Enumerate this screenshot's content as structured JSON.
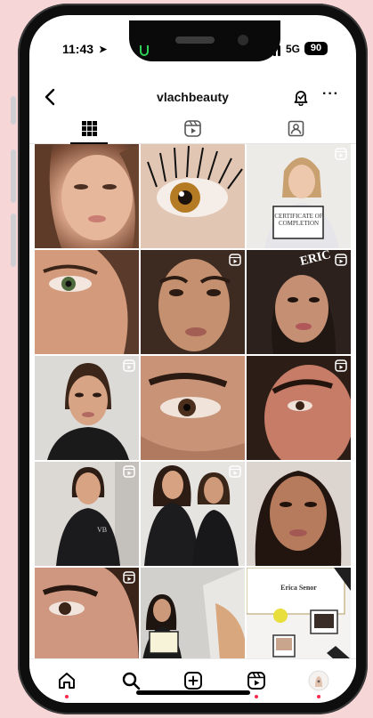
{
  "status_bar": {
    "time": "11:43",
    "network": "5G",
    "battery": "90"
  },
  "profile": {
    "username": "vlachbeauty"
  },
  "grid_posts": [
    {
      "caption": ""
    },
    {
      "caption": ""
    },
    {
      "caption": "CERTIFICATE OF COMPLETION"
    },
    {
      "caption": ""
    },
    {
      "caption": ""
    },
    {
      "caption": "ERIC"
    },
    {
      "caption": ""
    },
    {
      "caption": ""
    },
    {
      "caption": ""
    },
    {
      "caption": "VB"
    },
    {
      "caption": ""
    },
    {
      "caption": ""
    },
    {
      "caption": ""
    },
    {
      "caption": ""
    },
    {
      "caption": "Erica Senor"
    }
  ],
  "icons": {
    "back": "chevron-left-icon",
    "notifications": "bell-icon",
    "more": "more-icon",
    "grid_tab": "grid-icon",
    "reels_tab": "reels-icon",
    "tagged_tab": "tagged-icon",
    "home": "home-icon",
    "search": "search-icon",
    "create": "plus-square-icon",
    "reels": "reels-icon",
    "profile": "avatar"
  },
  "colors": {
    "background": "#f7d6d8",
    "notification_dot": "#ff2a4a"
  }
}
